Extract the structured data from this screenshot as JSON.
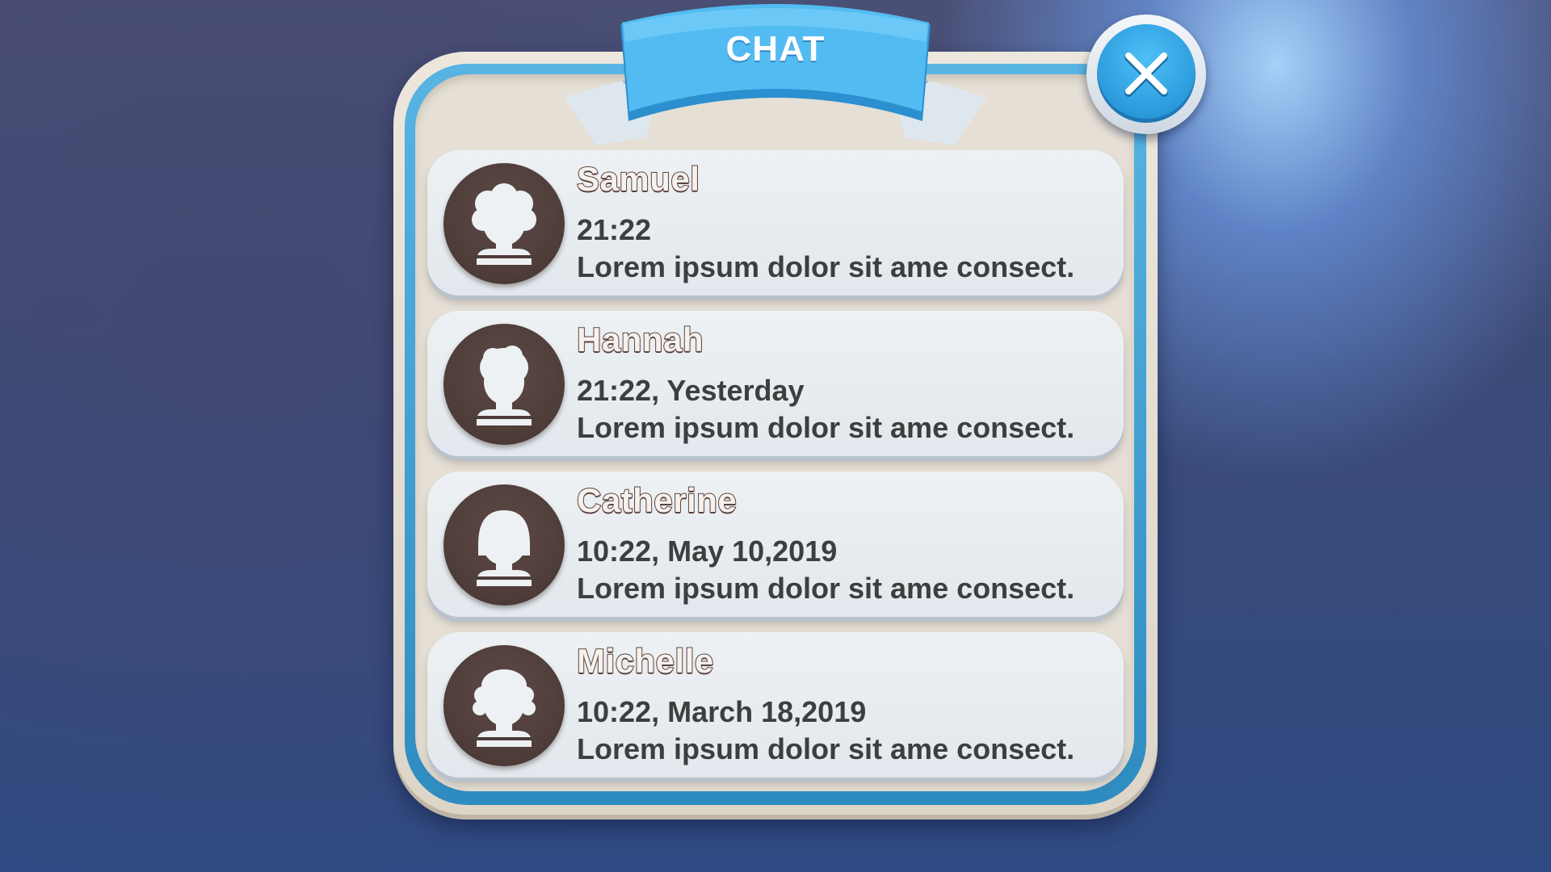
{
  "window": {
    "title": "CHAT",
    "close_icon": "close-x-icon"
  },
  "colors": {
    "ribbon": "#4fb6ee",
    "frame_blue": "#2f8cc0",
    "panel": "#e5dfd5",
    "row": "#e8edf1",
    "avatar": "#4d3c38",
    "text": "#3e3e3e"
  },
  "chats": [
    {
      "name": "Samuel",
      "time": "21:22",
      "message": "Lorem ipsum dolor sit ame consect.",
      "avatar_icon": "curly-hair-person-icon"
    },
    {
      "name": "Hannah",
      "time": "21:22, Yesterday",
      "message": "Lorem ipsum dolor sit ame consect.",
      "avatar_icon": "short-hair-person-icon"
    },
    {
      "name": "Catherine",
      "time": "10:22, May 10,2019",
      "message": "Lorem ipsum dolor sit ame consect.",
      "avatar_icon": "bob-hair-person-icon"
    },
    {
      "name": "Michelle",
      "time": "10:22, March 18,2019",
      "message": "Lorem ipsum dolor sit ame consect.",
      "avatar_icon": "bun-hair-person-icon"
    }
  ]
}
